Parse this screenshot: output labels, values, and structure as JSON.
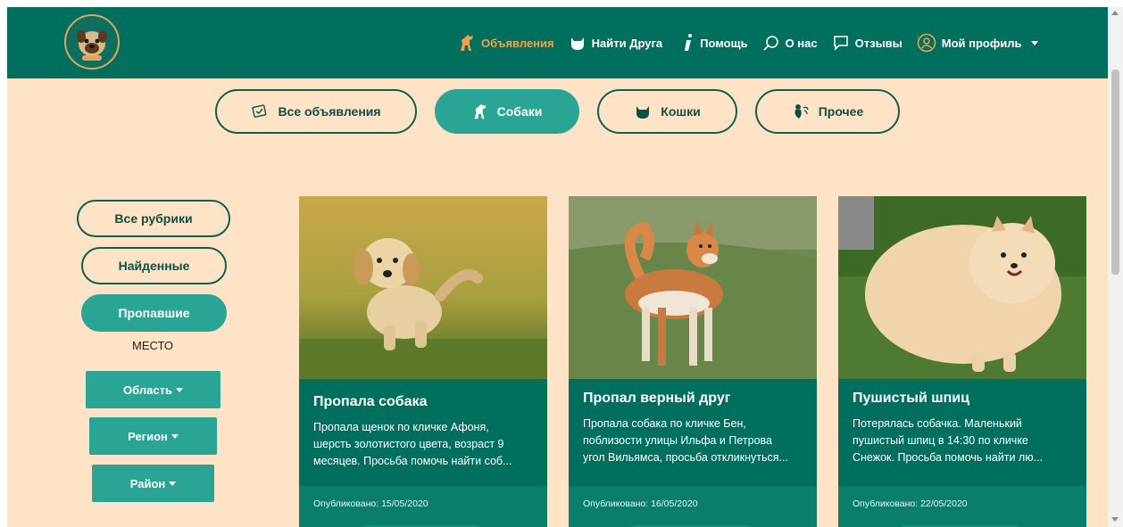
{
  "nav": {
    "items": [
      {
        "label": "Объявления",
        "icon": "dog-icon",
        "active": true
      },
      {
        "label": "Найти Друга",
        "icon": "cat-icon",
        "active": false
      },
      {
        "label": "Помощь",
        "icon": "info-icon",
        "active": false
      },
      {
        "label": "О нас",
        "icon": "search-icon",
        "active": false
      },
      {
        "label": "Отзывы",
        "icon": "chat-icon",
        "active": false
      },
      {
        "label": "Мой профиль",
        "icon": "user-icon",
        "active": false
      }
    ]
  },
  "categories": [
    {
      "label": "Все объявления",
      "icon": "ads-icon",
      "active": false
    },
    {
      "label": "Собаки",
      "icon": "dog-icon",
      "active": true
    },
    {
      "label": "Кошки",
      "icon": "cat-icon",
      "active": false
    },
    {
      "label": "Прочее",
      "icon": "bird-icon",
      "active": false
    }
  ],
  "sidebar": {
    "rubrics": [
      {
        "label": "Все рубрики",
        "active": false
      },
      {
        "label": "Найденные",
        "active": false
      },
      {
        "label": "Пропавшие",
        "active": true
      }
    ],
    "place_label": "МЕСТО",
    "dropdowns": [
      "Область",
      "Регион",
      "Район"
    ]
  },
  "cards": [
    {
      "title": "Пропала собака",
      "text": [
        "Пропала щенок по кличке Афоня,",
        "шерсть золотистого цвета, возраст 9",
        "месяцев. Просьба помочь найти соб..."
      ],
      "date": "Опубликовано: 15/05/2020"
    },
    {
      "title": "Пропал верный друг",
      "text": [
        "Пропала собака по кличке Бен,",
        "поблизости улицы Ильфа и Петрова",
        "угол Вильямса, просьба откликнуться..."
      ],
      "date": "Опубликовано: 16/05/2020"
    },
    {
      "title": "Пушистый шпиц",
      "text": [
        "Потерялась собачка. Маленький",
        "пушистый шпиц в 14:30 по кличке",
        "Снежок. Просьба помочь найти лю..."
      ],
      "date": "Опубликовано: 22/05/2020"
    }
  ],
  "colors": {
    "header": "#006f5e",
    "background": "#ffe3c6",
    "accent": "#2aa595",
    "active_nav": "#f2a14b"
  }
}
